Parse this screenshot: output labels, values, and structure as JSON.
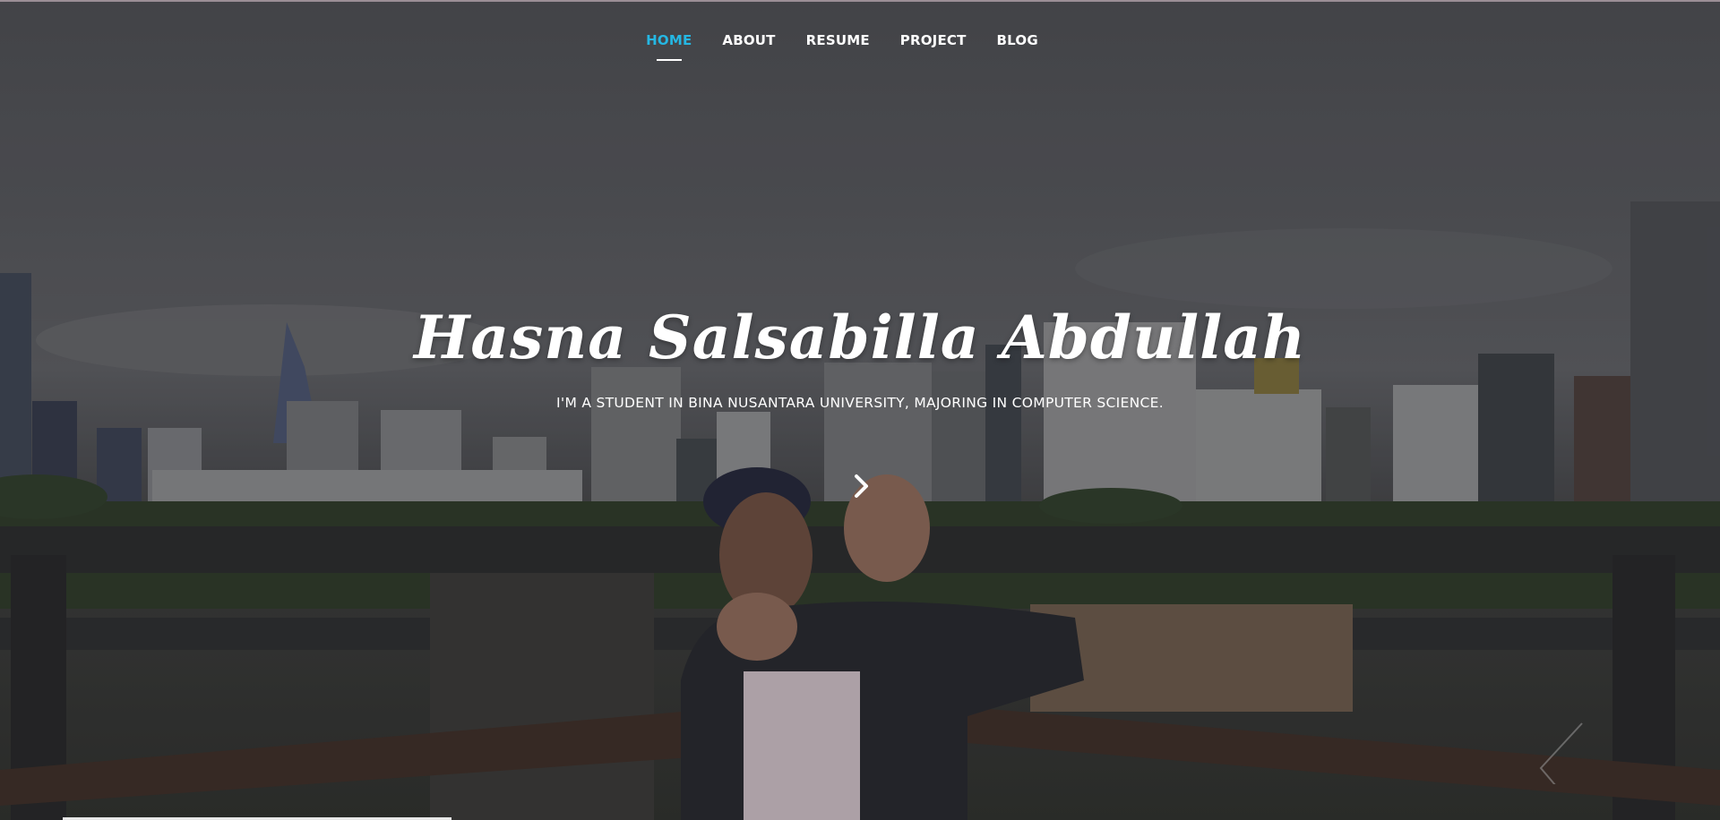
{
  "nav": {
    "items": [
      {
        "label": "HOME",
        "active": true
      },
      {
        "label": "ABOUT",
        "active": false
      },
      {
        "label": "RESUME",
        "active": false
      },
      {
        "label": "PROJECT",
        "active": false
      },
      {
        "label": "BLOG",
        "active": false
      }
    ]
  },
  "hero": {
    "title": "Hasna Salsabilla Abdullah",
    "subtitle": "I'M A STUDENT IN BINA NUSANTARA UNIVERSITY, MAJORING IN COMPUTER SCIENCE."
  },
  "icons": {
    "next": "chevron-right-icon",
    "corner": "chevron-left-icon"
  },
  "colors": {
    "accent": "#25b7e3",
    "text": "#ffffff"
  }
}
